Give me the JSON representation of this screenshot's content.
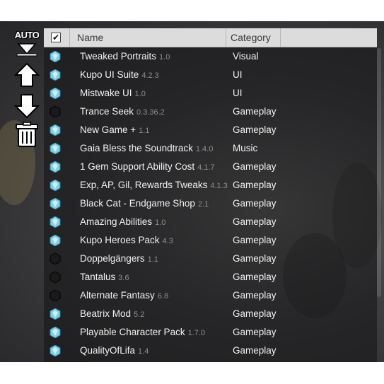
{
  "toolbar": {
    "auto_label": "AUTO",
    "buttons": [
      {
        "name": "auto-sort",
        "icon": "auto-sort-icon"
      },
      {
        "name": "move-up",
        "icon": "arrow-up-icon"
      },
      {
        "name": "move-down",
        "icon": "arrow-down-icon"
      },
      {
        "name": "delete",
        "icon": "trash-icon"
      }
    ]
  },
  "table": {
    "columns": {
      "check": "✔",
      "name": "Name",
      "category": "Category"
    },
    "rows": [
      {
        "name": "Tweaked Portraits",
        "version": "1.0",
        "category": "Visual",
        "icon": "gem-icon"
      },
      {
        "name": "Kupo UI Suite",
        "version": "4.2.3",
        "category": "UI",
        "icon": "gem-icon"
      },
      {
        "name": "Mistwake UI",
        "version": "1.0",
        "category": "UI",
        "icon": "gem-icon"
      },
      {
        "name": "Trance Seek",
        "version": "0.3.36.2",
        "category": "Gameplay",
        "icon": "dark-gem-icon"
      },
      {
        "name": "New Game +",
        "version": "1.1",
        "category": "Gameplay",
        "icon": "gem-icon"
      },
      {
        "name": "Gaia Bless the Soundtrack",
        "version": "1.4.0",
        "category": "Music",
        "icon": "gem-icon"
      },
      {
        "name": "1 Gem Support Ability Cost",
        "version": "4.1.7",
        "category": "Gameplay",
        "icon": "gem-icon"
      },
      {
        "name": "Exp, AP, Gil, Rewards Tweaks",
        "version": "4.1.3",
        "category": "Gameplay",
        "icon": "gem-icon"
      },
      {
        "name": "Black Cat - Endgame Shop",
        "version": "2.1",
        "category": "Gameplay",
        "icon": "gem-icon"
      },
      {
        "name": "Amazing Abilities",
        "version": "1.0",
        "category": "Gameplay",
        "icon": "gem-icon"
      },
      {
        "name": "Kupo Heroes Pack",
        "version": "4.3",
        "category": "Gameplay",
        "icon": "gem-icon"
      },
      {
        "name": "Doppelgängers",
        "version": "1.1",
        "category": "Gameplay",
        "icon": "dark-gem-icon"
      },
      {
        "name": "Tantalus",
        "version": "3.6",
        "category": "Gameplay",
        "icon": "dark-gem-icon"
      },
      {
        "name": "Alternate Fantasy",
        "version": "6.8",
        "category": "Gameplay",
        "icon": "dark-gem-icon"
      },
      {
        "name": "Beatrix Mod",
        "version": "5.2",
        "category": "Gameplay",
        "icon": "gem-icon"
      },
      {
        "name": "Playable Character Pack",
        "version": "1.7.0",
        "category": "Gameplay",
        "icon": "gem-icon"
      },
      {
        "name": "QualityOfLifa",
        "version": "1.4",
        "category": "Gameplay",
        "icon": "gem-icon"
      }
    ]
  },
  "colors": {
    "gem": "#7fd0e6",
    "gem_dark": "#1a1a1a",
    "header_bg": "#dcdcdc",
    "text": "#f2f2f2",
    "version_text": "#8e8e8e"
  }
}
